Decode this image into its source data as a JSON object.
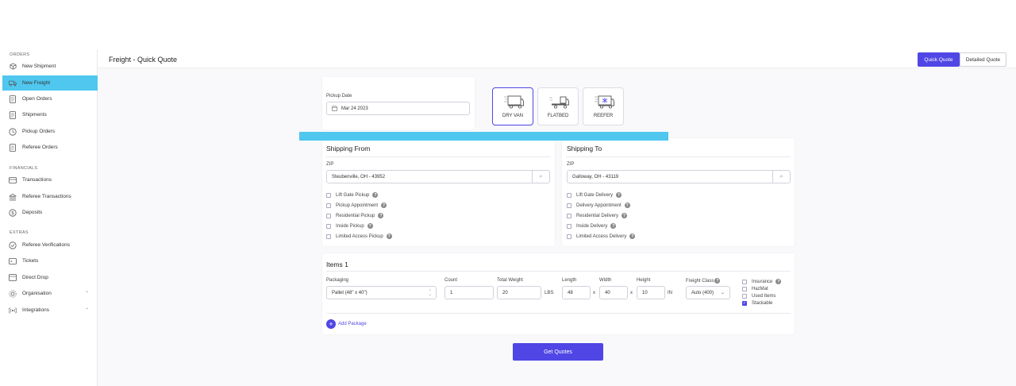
{
  "sidebar": {
    "sections": [
      {
        "title": "ORDERS",
        "items": [
          {
            "label": "New Shipment",
            "icon": "box-icon"
          },
          {
            "label": "New Freight",
            "icon": "truck-icon",
            "active": true
          },
          {
            "label": "Open Orders",
            "icon": "document-icon"
          },
          {
            "label": "Shipments",
            "icon": "document-icon"
          },
          {
            "label": "Pickup Orders",
            "icon": "clock-icon"
          },
          {
            "label": "Referee Orders",
            "icon": "document-icon"
          }
        ]
      },
      {
        "title": "FINANCIALS",
        "items": [
          {
            "label": "Transactions",
            "icon": "wallet-icon"
          },
          {
            "label": "Referee Transactions",
            "icon": "bank-icon"
          },
          {
            "label": "Deposits",
            "icon": "dollar-icon"
          }
        ]
      },
      {
        "title": "EXTRAS",
        "items": [
          {
            "label": "Referee Verifications",
            "icon": "check-circle-icon"
          },
          {
            "label": "Tickets",
            "icon": "ticket-icon"
          },
          {
            "label": "Direct Drop",
            "icon": "drop-icon"
          },
          {
            "label": "Organisation",
            "icon": "org-icon",
            "expandable": true
          },
          {
            "label": "Integrations",
            "icon": "signal-icon",
            "expandable": true
          }
        ]
      }
    ]
  },
  "header": {
    "title": "Freight - Quick Quote",
    "quick_quote": "Quick Quote",
    "detailed_quote": "Detailed Quote"
  },
  "pickup": {
    "label": "Pickup Date",
    "value": "Mar 24 2023"
  },
  "trucks": [
    {
      "label": "DRY VAN",
      "icon": "dry-van-icon",
      "selected": true
    },
    {
      "label": "FLATBED",
      "icon": "flatbed-icon",
      "selected": false
    },
    {
      "label": "REEFER",
      "icon": "reefer-icon",
      "selected": false
    }
  ],
  "shipping_from": {
    "title": "Shipping From",
    "zip_label": "ZIP",
    "zip_value": "Steubenville, OH - 43952",
    "options": [
      "Lift Gate Pickup",
      "Pickup Appointment",
      "Residential Pickup",
      "Inside Pickup",
      "Limited Access Pickup"
    ]
  },
  "shipping_to": {
    "title": "Shipping To",
    "zip_label": "ZIP",
    "zip_value": "Galloway, OH - 43119",
    "options": [
      "Lift Gate Delivery",
      "Delivery Appointment",
      "Residential Delivery",
      "Inside Delivery",
      "Limited Access Delivery"
    ]
  },
  "items": {
    "title": "Items 1",
    "packaging_label": "Packaging",
    "packaging_value": "Pallet (48\" x 40\")",
    "count_label": "Count",
    "count_value": "1",
    "weight_label": "Total Weight",
    "weight_value": "20",
    "weight_unit": "LBS",
    "length_label": "Length",
    "length_value": "48",
    "width_label": "Width",
    "width_value": "40",
    "height_label": "Height",
    "height_value": "10",
    "dim_unit": "IN",
    "x_sep": "x",
    "class_label": "Freight Class",
    "class_value": "Auto (400)",
    "flags": [
      {
        "label": "Insurance",
        "checked": false,
        "help": true
      },
      {
        "label": "HazMat",
        "checked": false,
        "help": false
      },
      {
        "label": "Used Items",
        "checked": false,
        "help": false
      },
      {
        "label": "Stackable",
        "checked": true,
        "help": false
      }
    ],
    "add_package": "Add Package"
  },
  "submit": "Get Quotes",
  "colors": {
    "accent": "#4f46e5",
    "highlight": "#4fc7ef"
  }
}
